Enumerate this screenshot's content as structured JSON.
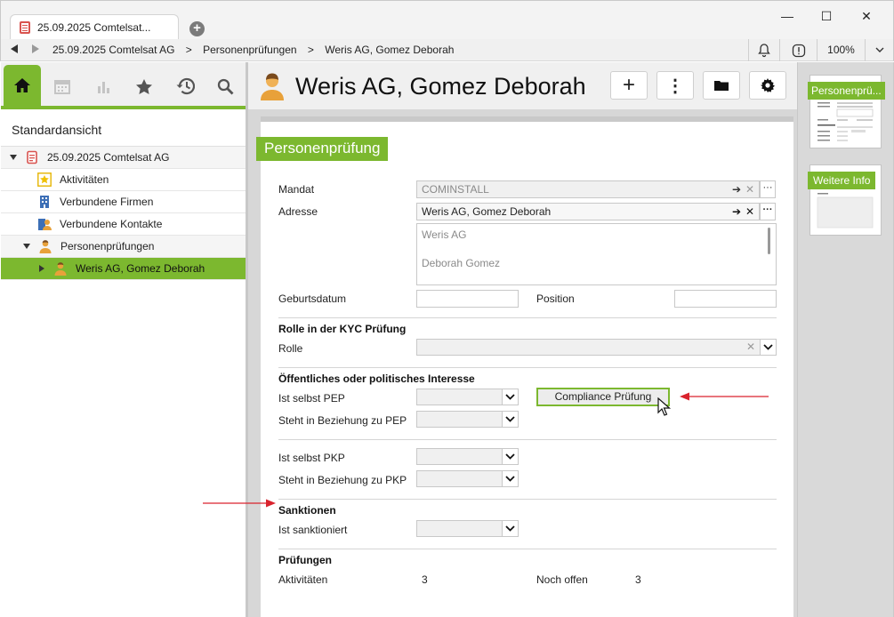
{
  "window": {
    "tab_title": "25.09.2025 Comtelsat...",
    "minimize": "—",
    "maximize": "☐",
    "close": "✕"
  },
  "addressbar": {
    "breadcrumbs": [
      "25.09.2025 Comtelsat AG",
      ">",
      "Personenprüfungen",
      ">",
      "Weris AG, Gomez Deborah"
    ],
    "zoom": "100%"
  },
  "sidebar": {
    "title": "Standardansicht",
    "items": [
      {
        "label": "25.09.2025 Comtelsat AG"
      },
      {
        "label": "Aktivitäten"
      },
      {
        "label": "Verbundene Firmen"
      },
      {
        "label": "Verbundene Kontakte"
      },
      {
        "label": "Personenprüfungen"
      },
      {
        "label": "Weris AG, Gomez Deborah"
      }
    ]
  },
  "header": {
    "title": "Weris AG, Gomez Deborah",
    "add": "+",
    "more": "⋮"
  },
  "form": {
    "section_title": "Personenprüfung",
    "mandat_label": "Mandat",
    "mandat_value": "COMINSTALL",
    "adresse_label": "Adresse",
    "adresse_value": "Weris AG, Gomez Deborah",
    "address_lines": [
      "Weris AG",
      "Deborah Gomez"
    ],
    "geburtsdatum_label": "Geburtsdatum",
    "position_label": "Position",
    "kyc_header": "Rolle in der KYC Prüfung",
    "rolle_label": "Rolle",
    "pep_header": "Öffentliches oder politisches Interesse",
    "selbst_pep_label": "Ist selbst PEP",
    "compliance_button": "Compliance Prüfung",
    "beziehung_pep_label": "Steht in Beziehung zu PEP",
    "selbst_pkp_label": "Ist selbst PKP",
    "beziehung_pkp_label": "Steht in Beziehung zu PKP",
    "sanktionen_header": "Sanktionen",
    "sanktioniert_label": "Ist sanktioniert",
    "pruefungen_header": "Prüfungen",
    "aktivitaeten_label": "Aktivitäten",
    "aktivitaeten_value": "3",
    "offen_label": "Noch offen",
    "offen_value": "3"
  },
  "rail": {
    "thumbs": [
      {
        "label": "Personenprü..."
      },
      {
        "label": "Weitere Info"
      }
    ]
  },
  "colors": {
    "accent": "#7cb82f",
    "arrow": "#d9232d"
  }
}
